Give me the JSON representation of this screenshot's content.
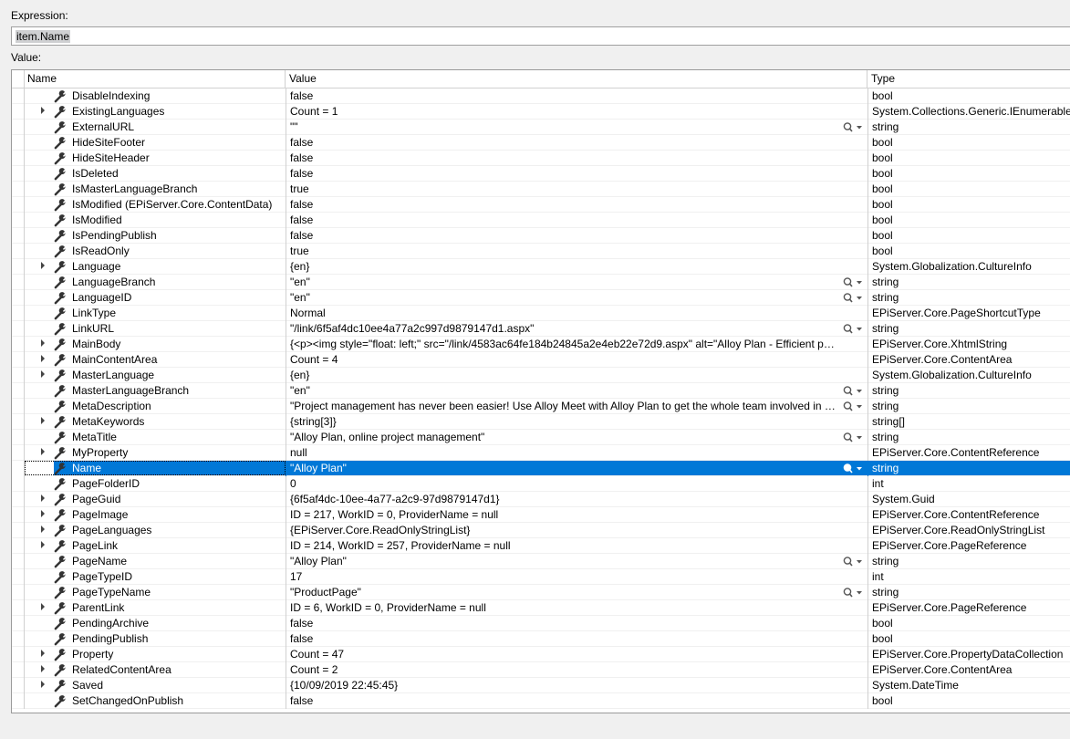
{
  "expression": {
    "label": "Expression:",
    "value": "item.Name"
  },
  "value_label": "Value:",
  "columns": {
    "name": "Name",
    "value": "Value",
    "type": "Type"
  },
  "rows": [
    {
      "name": "DisableIndexing",
      "value": "false",
      "type": "bool",
      "expandable": false,
      "viz": false
    },
    {
      "name": "ExistingLanguages",
      "value": "Count = 1",
      "type": "System.Collections.Generic.IEnumerable<",
      "expandable": true,
      "viz": false
    },
    {
      "name": "ExternalURL",
      "value": "\"\"",
      "type": "string",
      "expandable": false,
      "viz": true
    },
    {
      "name": "HideSiteFooter",
      "value": "false",
      "type": "bool",
      "expandable": false,
      "viz": false
    },
    {
      "name": "HideSiteHeader",
      "value": "false",
      "type": "bool",
      "expandable": false,
      "viz": false
    },
    {
      "name": "IsDeleted",
      "value": "false",
      "type": "bool",
      "expandable": false,
      "viz": false
    },
    {
      "name": "IsMasterLanguageBranch",
      "value": "true",
      "type": "bool",
      "expandable": false,
      "viz": false
    },
    {
      "name": "IsModified (EPiServer.Core.ContentData)",
      "value": "false",
      "type": "bool",
      "expandable": false,
      "viz": false
    },
    {
      "name": "IsModified",
      "value": "false",
      "type": "bool",
      "expandable": false,
      "viz": false
    },
    {
      "name": "IsPendingPublish",
      "value": "false",
      "type": "bool",
      "expandable": false,
      "viz": false
    },
    {
      "name": "IsReadOnly",
      "value": "true",
      "type": "bool",
      "expandable": false,
      "viz": false
    },
    {
      "name": "Language",
      "value": "{en}",
      "type": "System.Globalization.CultureInfo",
      "expandable": true,
      "viz": false
    },
    {
      "name": "LanguageBranch",
      "value": "\"en\"",
      "type": "string",
      "expandable": false,
      "viz": true
    },
    {
      "name": "LanguageID",
      "value": "\"en\"",
      "type": "string",
      "expandable": false,
      "viz": true
    },
    {
      "name": "LinkType",
      "value": "Normal",
      "type": "EPiServer.Core.PageShortcutType",
      "expandable": false,
      "viz": false
    },
    {
      "name": "LinkURL",
      "value": "\"/link/6f5af4dc10ee4a77a2c997d9879147d1.aspx\"",
      "type": "string",
      "expandable": false,
      "viz": true
    },
    {
      "name": "MainBody",
      "value": "{<p><img style=\"float: left;\" src=\"/link/4583ac64fe184b24845a2e4eb22e72d9.aspx\" alt=\"Alloy Plan - Efficient project p...",
      "type": "EPiServer.Core.XhtmlString",
      "expandable": true,
      "viz": false
    },
    {
      "name": "MainContentArea",
      "value": "Count = 4",
      "type": "EPiServer.Core.ContentArea",
      "expandable": true,
      "viz": false
    },
    {
      "name": "MasterLanguage",
      "value": "{en}",
      "type": "System.Globalization.CultureInfo",
      "expandable": true,
      "viz": false
    },
    {
      "name": "MasterLanguageBranch",
      "value": "\"en\"",
      "type": "string",
      "expandable": false,
      "viz": true
    },
    {
      "name": "MetaDescription",
      "value": "\"Project management has never been easier! Use Alloy Meet with Alloy Plan to get the whole team involved in th...",
      "type": "string",
      "expandable": false,
      "viz": true
    },
    {
      "name": "MetaKeywords",
      "value": "{string[3]}",
      "type": "string[]",
      "expandable": true,
      "viz": false
    },
    {
      "name": "MetaTitle",
      "value": "\"Alloy Plan, online project management\"",
      "type": "string",
      "expandable": false,
      "viz": true
    },
    {
      "name": "MyProperty",
      "value": "null",
      "type": "EPiServer.Core.ContentReference",
      "expandable": true,
      "viz": false
    },
    {
      "name": "Name",
      "value": "\"Alloy Plan\"",
      "type": "string",
      "expandable": false,
      "viz": true,
      "selected": true
    },
    {
      "name": "PageFolderID",
      "value": "0",
      "type": "int",
      "expandable": false,
      "viz": false
    },
    {
      "name": "PageGuid",
      "value": "{6f5af4dc-10ee-4a77-a2c9-97d9879147d1}",
      "type": "System.Guid",
      "expandable": true,
      "viz": false
    },
    {
      "name": "PageImage",
      "value": "ID = 217, WorkID = 0, ProviderName = null",
      "type": "EPiServer.Core.ContentReference",
      "expandable": true,
      "viz": false
    },
    {
      "name": "PageLanguages",
      "value": "{EPiServer.Core.ReadOnlyStringList}",
      "type": "EPiServer.Core.ReadOnlyStringList",
      "expandable": true,
      "viz": false
    },
    {
      "name": "PageLink",
      "value": "ID = 214, WorkID = 257, ProviderName = null",
      "type": "EPiServer.Core.PageReference",
      "expandable": true,
      "viz": false
    },
    {
      "name": "PageName",
      "value": "\"Alloy Plan\"",
      "type": "string",
      "expandable": false,
      "viz": true
    },
    {
      "name": "PageTypeID",
      "value": "17",
      "type": "int",
      "expandable": false,
      "viz": false
    },
    {
      "name": "PageTypeName",
      "value": "\"ProductPage\"",
      "type": "string",
      "expandable": false,
      "viz": true
    },
    {
      "name": "ParentLink",
      "value": "ID = 6, WorkID = 0, ProviderName = null",
      "type": "EPiServer.Core.PageReference",
      "expandable": true,
      "viz": false
    },
    {
      "name": "PendingArchive",
      "value": "false",
      "type": "bool",
      "expandable": false,
      "viz": false
    },
    {
      "name": "PendingPublish",
      "value": "false",
      "type": "bool",
      "expandable": false,
      "viz": false
    },
    {
      "name": "Property",
      "value": "Count = 47",
      "type": "EPiServer.Core.PropertyDataCollection",
      "expandable": true,
      "viz": false
    },
    {
      "name": "RelatedContentArea",
      "value": "Count = 2",
      "type": "EPiServer.Core.ContentArea",
      "expandable": true,
      "viz": false
    },
    {
      "name": "Saved",
      "value": "{10/09/2019 22:45:45}",
      "type": "System.DateTime",
      "expandable": true,
      "viz": false
    },
    {
      "name": "SetChangedOnPublish",
      "value": "false",
      "type": "bool",
      "expandable": false,
      "viz": false
    }
  ]
}
